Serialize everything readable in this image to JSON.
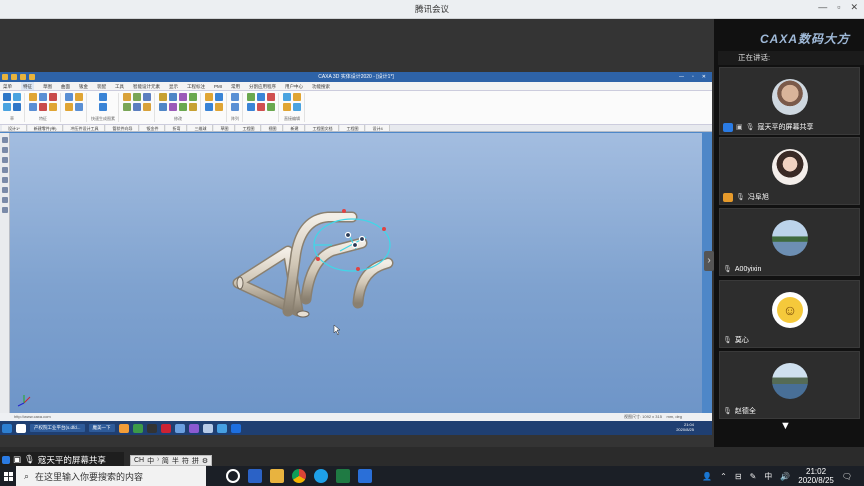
{
  "window": {
    "title": "腾讯会议"
  },
  "brand": {
    "logo_text": "CAXA数码大方"
  },
  "cad": {
    "title": "CAXA 3D 实体设计2020 - [设计1*]",
    "menu": [
      "菜单",
      "特征",
      "草图",
      "曲面",
      "钣金",
      "装配",
      "工具",
      "智能设计元素",
      "显示",
      "工程标注",
      "PMI",
      "常用",
      "分割应用程序",
      "用户中心",
      "功能搜索"
    ],
    "active_menu": "特征",
    "ribbon_groups": [
      {
        "label": "草",
        "colors": [
          "#2f77c8",
          "#4aa3e0"
        ]
      },
      {
        "label": "特征",
        "colors": [
          "#e0a534",
          "#5a8fd4",
          "#c94b4b"
        ]
      },
      {
        "label": "",
        "colors": [
          "#5a8fd4",
          "#e0a534"
        ]
      },
      {
        "label": "快速生成图素",
        "colors": [
          "#3a84d6"
        ]
      },
      {
        "label": "",
        "colors": [
          "#d9a23a",
          "#7aa657",
          "#5c7fc0"
        ]
      },
      {
        "label": "修改",
        "colors": [
          "#c7a132",
          "#4f86c6",
          "#9c5ab8",
          "#6aa84f"
        ]
      },
      {
        "label": "",
        "colors": [
          "#e0a534",
          "#3a84d6"
        ]
      },
      {
        "label": "阵列",
        "colors": [
          "#5a8fd4"
        ]
      },
      {
        "label": "",
        "colors": [
          "#6aa84f",
          "#3a84d6",
          "#d04f4f"
        ]
      },
      {
        "label": "直接编辑",
        "colors": [
          "#4aa3e0",
          "#e0a534"
        ]
      }
    ],
    "doc_tabs": [
      "设计1*",
      "新建零件(单)",
      "冲压件设计工具",
      "管状件向导",
      "钣金件",
      "折弯",
      "三维球",
      "草图",
      "工程图",
      "视图",
      "新建",
      "工程图文档",
      "工程图",
      "设计4"
    ],
    "status_left": "http://www.caxa.com",
    "status_right": "视图尺寸: 1092 x 315",
    "status_unit": "mm, deg",
    "taskbar_app": "产权院工业平台(s.dfd...",
    "taskbar_item2": "魔美一下",
    "inner_time": "21:04",
    "inner_date": "2020/8/25"
  },
  "share_status": "寇天平的屏幕共享",
  "ime_items": [
    "CH",
    "中",
    "⁾",
    "简",
    "半",
    "符",
    "拼",
    "⚙"
  ],
  "panel": {
    "speaking_label": "正在讲话:",
    "participants": [
      {
        "name": "寇天平的屏幕共享",
        "badge": "share",
        "avatar": "old"
      },
      {
        "name": "冯阜旭",
        "badge": "user",
        "avatar": "woman"
      },
      {
        "name": "A00yixin",
        "badge": "none",
        "avatar": "lake"
      },
      {
        "name": "莫心",
        "badge": "none",
        "avatar": "smile"
      },
      {
        "name": "赵德全",
        "badge": "none",
        "avatar": "lake2"
      }
    ]
  },
  "taskbar": {
    "search_placeholder": "在这里输入你要搜索的内容",
    "time": "21:02",
    "date": "2020/8/25",
    "tray_lang": "中"
  }
}
